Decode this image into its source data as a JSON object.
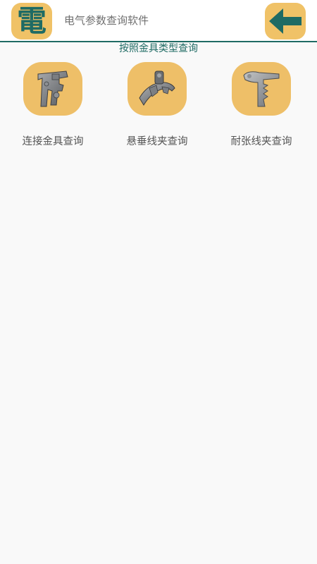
{
  "header": {
    "logo_char": "電",
    "app_title": "电气参数查询软件"
  },
  "colors": {
    "accent": "#1f6b64",
    "tile": "#f0c267"
  },
  "icons": {
    "back": "arrow-left-icon"
  },
  "section_title": "按照金具类型查询",
  "categories": [
    {
      "label": "连接金具查询",
      "icon": "connection-fitting-icon"
    },
    {
      "label": "悬垂线夹查询",
      "icon": "suspension-clamp-icon"
    },
    {
      "label": "耐张线夹查询",
      "icon": "tension-clamp-icon"
    }
  ]
}
